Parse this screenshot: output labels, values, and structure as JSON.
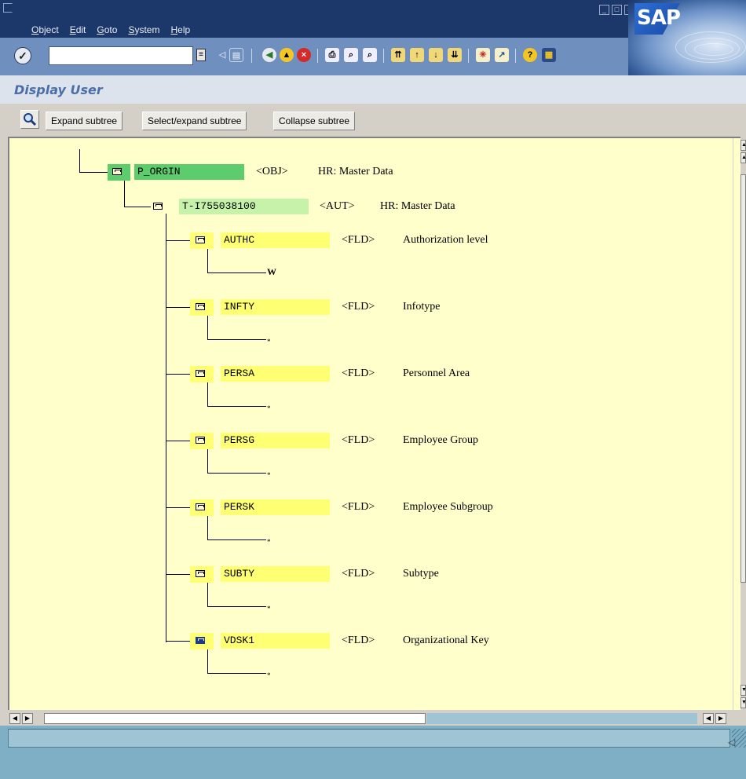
{
  "menu": [
    "Object",
    "Edit",
    "Goto",
    "System",
    "Help"
  ],
  "brand": "SAP",
  "screen_title": "Display User",
  "app_toolbar": {
    "expand": "Expand subtree",
    "select_expand": "Select/expand subtree",
    "collapse": "Collapse subtree"
  },
  "tree": {
    "root": {
      "name": "P_ORGIN",
      "type": "<OBJ>",
      "desc": "HR: Master Data"
    },
    "auth": {
      "name": "T-I755038100",
      "type": "<AUT>",
      "desc": "HR: Master Data"
    },
    "fields": [
      {
        "name": "AUTHC",
        "type": "<FLD>",
        "desc": "Authorization level",
        "value": "W"
      },
      {
        "name": "INFTY",
        "type": "<FLD>",
        "desc": "Infotype",
        "value": "*"
      },
      {
        "name": "PERSA",
        "type": "<FLD>",
        "desc": "Personnel Area",
        "value": "*"
      },
      {
        "name": "PERSG",
        "type": "<FLD>",
        "desc": "Employee Group",
        "value": "*"
      },
      {
        "name": "PERSK",
        "type": "<FLD>",
        "desc": "Employee Subgroup",
        "value": "*"
      },
      {
        "name": "SUBTY",
        "type": "<FLD>",
        "desc": "Subtype",
        "value": "*"
      },
      {
        "name": "VDSK1",
        "type": "<FLD>",
        "desc": "Organizational Key",
        "value": "*"
      }
    ]
  },
  "colors": {
    "title_bar": "#1c3769",
    "toolbar": "#6f8fbf",
    "tree_background": "#ffffcc",
    "object_highlight": "#5ccc6c",
    "auth_highlight": "#c6f3a9",
    "field_highlight": "#ffff73",
    "selected_icon": "#1e3a8a",
    "status_bar": "#7fafc4"
  }
}
